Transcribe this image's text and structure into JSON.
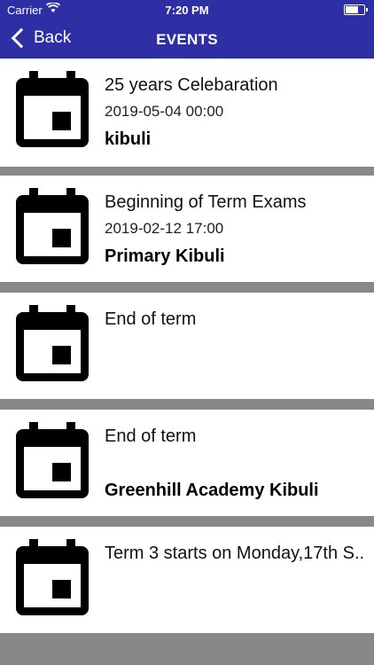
{
  "status_bar": {
    "carrier": "Carrier",
    "time": "7:20 PM"
  },
  "nav": {
    "back_label": "Back",
    "title": "EVENTS"
  },
  "events": [
    {
      "title": "25 years Celebaration",
      "datetime": "2019-05-04 00:00",
      "location": "kibuli"
    },
    {
      "title": "Beginning of Term Exams",
      "datetime": "2019-02-12 17:00",
      "location": "Primary Kibuli"
    },
    {
      "title": "End of term",
      "datetime": "",
      "location": ""
    },
    {
      "title": "End of term",
      "datetime": "",
      "location": "Greenhill Academy Kibuli"
    },
    {
      "title": "Term 3 starts on Monday,17th S...",
      "datetime": "",
      "location": ""
    }
  ],
  "colors": {
    "header": "#2e2fa4",
    "separator": "#888888",
    "icon": "#000000"
  },
  "icons": {
    "event": "calendar-icon",
    "back": "chevron-left-icon"
  }
}
